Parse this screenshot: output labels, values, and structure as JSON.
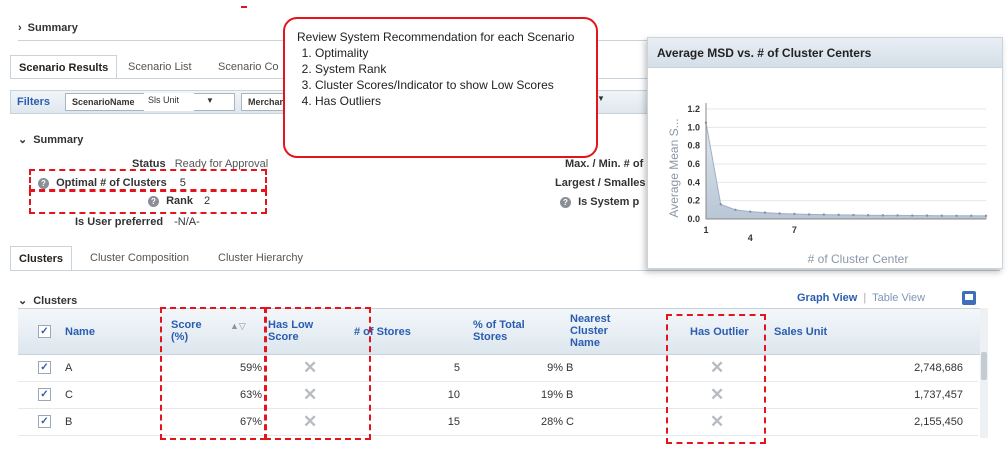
{
  "top_summary": {
    "label": "Summary"
  },
  "tabs": [
    "Scenario Results",
    "Scenario List",
    "Scenario Co"
  ],
  "filters": {
    "label": "Filters",
    "scenario_label": "ScenarioName",
    "scenario_value": "Sls Unit",
    "merch_label": "Merchan"
  },
  "summary": {
    "title": "Summary",
    "status_label": "Status",
    "status_value": "Ready for Approval",
    "optimal_label": "Optimal # of Clusters",
    "optimal_value": "5",
    "rank_label": "Rank",
    "rank_value": "2",
    "user_pref_label": "Is User preferred",
    "user_pref_value": "-N/A-",
    "maxmin_label": "Max. / Min. # of",
    "largest_label": "Largest / Smalles",
    "is_system_label": "Is System p"
  },
  "sub_tabs": [
    "Clusters",
    "Cluster Composition",
    "Cluster Hierarchy"
  ],
  "clusters": {
    "title": "Clusters",
    "graph_view": "Graph View",
    "table_view": "Table View",
    "columns": {
      "name": "Name",
      "score": "Score (%)",
      "has_low": "Has Low Score",
      "stores": "# of Stores",
      "pct": "% of Total Stores",
      "nearest": "Nearest Cluster Name",
      "outlier": "Has Outlier",
      "sales": "Sales Unit"
    },
    "rows": [
      {
        "name": "A",
        "score": "59%",
        "stores": "5",
        "pct": "9%",
        "nearest": "B",
        "sales": "2,748,686"
      },
      {
        "name": "C",
        "score": "63%",
        "stores": "10",
        "pct": "19%",
        "nearest": "B",
        "sales": "1,737,457"
      },
      {
        "name": "B",
        "score": "67%",
        "stores": "15",
        "pct": "28%",
        "nearest": "C",
        "sales": "2,155,450"
      }
    ]
  },
  "callout": {
    "intro": "Review System Recommendation for each Scenario",
    "items": [
      "Optimality",
      "System Rank",
      "Cluster Scores/Indicator to show Low Scores",
      "Has Outliers"
    ]
  },
  "chart_data": {
    "type": "area",
    "title": "Average MSD vs. # of Cluster Centers",
    "xlabel": "# of Cluster Center",
    "ylabel": "Average Mean S...",
    "x_ticks": [
      "1",
      "4",
      "7"
    ],
    "y_ticks": [
      "0.0",
      "0.2",
      "0.4",
      "0.6",
      "0.8",
      "1.0",
      "1.2"
    ],
    "ylim": [
      0,
      1.2
    ],
    "x": [
      1,
      2,
      3,
      4,
      5,
      6,
      7,
      8,
      9,
      10,
      11,
      12,
      13,
      14,
      15,
      16,
      17,
      18,
      19,
      20
    ],
    "values": [
      1.05,
      0.16,
      0.1,
      0.08,
      0.07,
      0.06,
      0.055,
      0.05,
      0.048,
      0.045,
      0.043,
      0.041,
      0.04,
      0.039,
      0.038,
      0.037,
      0.036,
      0.035,
      0.035,
      0.034
    ],
    "grid": true
  }
}
